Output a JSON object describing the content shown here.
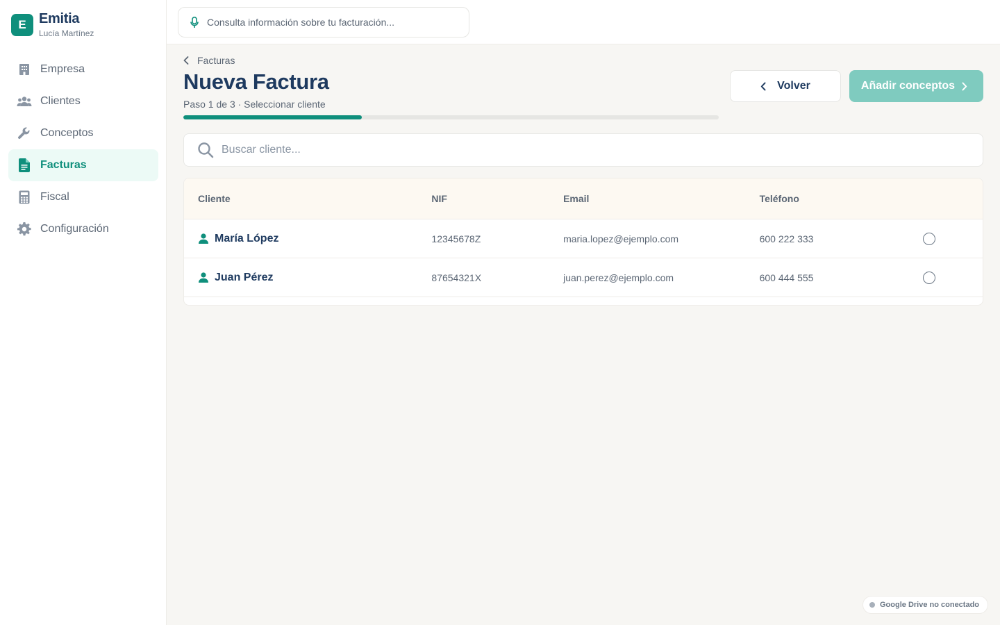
{
  "brand": {
    "logo_letter": "E",
    "name": "Emitia",
    "user": "Lucía Martínez"
  },
  "sidebar": {
    "items": [
      {
        "label": "Empresa",
        "icon": "building-icon"
      },
      {
        "label": "Clientes",
        "icon": "users-icon"
      },
      {
        "label": "Conceptos",
        "icon": "wrench-icon"
      },
      {
        "label": "Facturas",
        "icon": "document-icon",
        "active": true
      },
      {
        "label": "Fiscal",
        "icon": "calculator-icon"
      },
      {
        "label": "Configuración",
        "icon": "gear-icon"
      }
    ]
  },
  "topbar": {
    "search_placeholder": "Consulta información sobre tu facturación...",
    "icon": "microphone-icon"
  },
  "header": {
    "breadcrumb": "Facturas",
    "title": "Nueva Factura",
    "step": "Paso 1 de 3 · Seleccionar cliente",
    "progress_fraction": 0.333
  },
  "actions": {
    "back_label": "Volver",
    "next_label": "Añadir conceptos"
  },
  "client_search": {
    "placeholder": "Buscar cliente..."
  },
  "table": {
    "columns": [
      "Cliente",
      "NIF",
      "Email",
      "Teléfono"
    ],
    "rows": [
      {
        "name": "María López",
        "nif": "12345678Z",
        "email": "maria.lopez@ejemplo.com",
        "phone": "600 222 333",
        "selected": false
      },
      {
        "name": "Juan Pérez",
        "nif": "87654321X",
        "email": "juan.perez@ejemplo.com",
        "phone": "600 444 555",
        "selected": false
      }
    ]
  },
  "status": {
    "drive": "Google Drive no conectado"
  },
  "colors": {
    "accent": "#0f8f7c",
    "accent_light": "#7fcbbf",
    "title": "#1e3a5f",
    "active_bg": "#ecfaf6"
  }
}
